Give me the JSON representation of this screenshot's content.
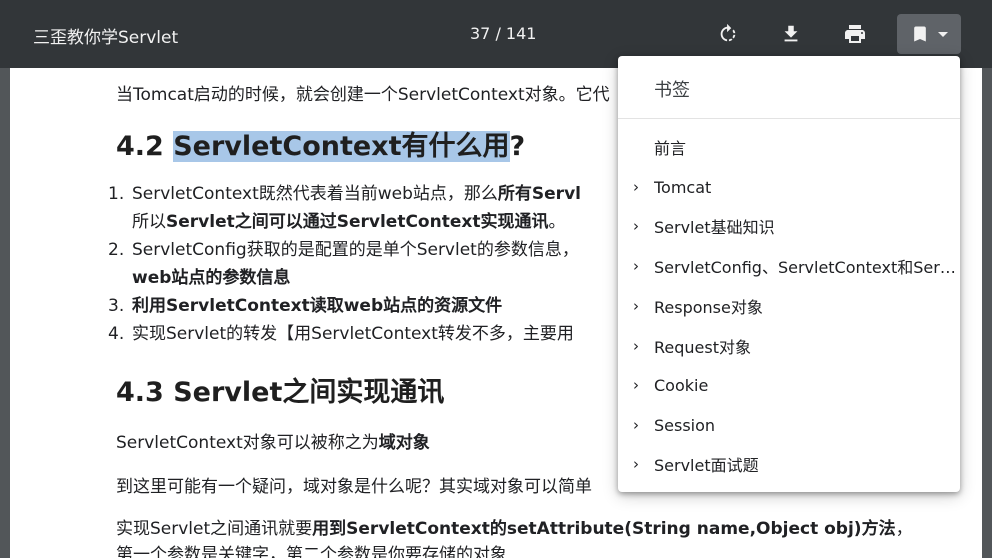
{
  "toolbar": {
    "title": "三歪教你学Servlet",
    "page_indicator": "37 / 141",
    "buttons": {
      "rotate": "rotate-icon",
      "download": "download-icon",
      "print": "print-icon",
      "bookmark": "bookmark-icon"
    }
  },
  "document": {
    "intro": "当Tomcat启动的时候，就会创建一个ServletContext对象。它代",
    "heading_4_2_num": "4.2 ",
    "heading_4_2_hl": "ServletContext有什么用",
    "heading_4_2_tail": "?",
    "list": [
      {
        "num": "1.",
        "line1_plain": "ServletContext既然代表着当前web站点，那么",
        "line1_bold": "所有Servl",
        "line2_plain_a": "所以",
        "line2_bold": "Servlet之间可以通过ServletContext实现通讯",
        "line2_plain_b": "。"
      },
      {
        "num": "2.",
        "line1_plain": "ServletConfig获取的是配置的是单个Servlet的参数信息，",
        "line2_bold": "web站点的参数信息"
      },
      {
        "num": "3.",
        "bold": "利用ServletContext读取web站点的资源文件"
      },
      {
        "num": "4.",
        "plain": "实现Servlet的转发【用ServletContext转发不多，主要用"
      }
    ],
    "heading_4_3": "4.3 Servlet之间实现通讯",
    "p1_plain": "ServletContext对象可以被称之为",
    "p1_bold": "域对象",
    "p2": "到这里可能有一个疑问，域对象是什么呢？其实域对象可以简单",
    "p3_plain": "实现Servlet之间通讯就要",
    "p3_bold": "用到ServletContext的setAttribute(String name,Object obj)方法",
    "p3_tail": "，",
    "p4": "第一个参数是关键字，第二个参数是你要存储的对象"
  },
  "bookmarks": {
    "title": "书签",
    "items": [
      {
        "label": "前言",
        "expandable": false
      },
      {
        "label": "Tomcat",
        "expandable": true
      },
      {
        "label": "Servlet基础知识",
        "expandable": true
      },
      {
        "label": "ServletConfig、ServletContext和Servlet...",
        "expandable": true
      },
      {
        "label": "Response对象",
        "expandable": true
      },
      {
        "label": "Request对象",
        "expandable": true
      },
      {
        "label": "Cookie",
        "expandable": true
      },
      {
        "label": "Session",
        "expandable": true
      },
      {
        "label": "Servlet面试题",
        "expandable": true
      }
    ]
  }
}
